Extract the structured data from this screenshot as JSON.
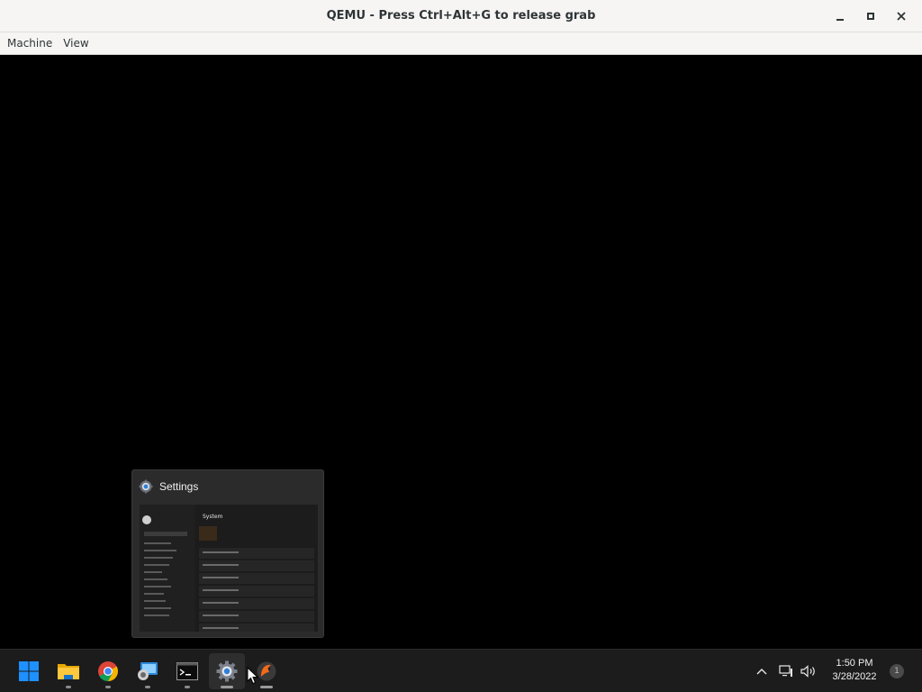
{
  "window": {
    "title": "QEMU - Press Ctrl+Alt+G to release grab",
    "controls": [
      "minimize-icon",
      "maximize-icon",
      "close-icon"
    ]
  },
  "menubar": {
    "items": [
      {
        "label": "Machine"
      },
      {
        "label": "View"
      }
    ]
  },
  "preview": {
    "app_title": "Settings",
    "icon": "gear-icon",
    "thumbnail": {
      "page_heading": "System"
    }
  },
  "taskbar": {
    "apps": [
      {
        "name": "start",
        "icon": "windows-logo-icon"
      },
      {
        "name": "file-explorer",
        "icon": "folder-icon"
      },
      {
        "name": "chrome",
        "icon": "chrome-icon"
      },
      {
        "name": "remote-desktop",
        "icon": "remote-desktop-icon"
      },
      {
        "name": "terminal",
        "icon": "terminal-icon"
      },
      {
        "name": "settings",
        "icon": "gear-icon"
      },
      {
        "name": "app",
        "icon": "app-icon"
      }
    ],
    "tray": {
      "clock_time": "1:50 PM",
      "clock_date": "3/28/2022",
      "notification_count": "1"
    }
  },
  "colors": {
    "titlebar_bg": "#f6f5f4",
    "guest_bg": "#000000",
    "taskbar_bg": "#1c1c1c",
    "windows_blue": "#1e90ff"
  }
}
